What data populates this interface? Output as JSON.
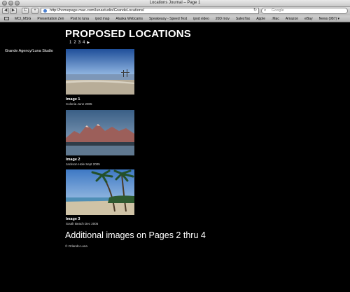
{
  "browser": {
    "window_title": "Locations Journal – Page 1",
    "back_label": "◀",
    "forward_label": "▶",
    "reload_label": "C",
    "add_label": "+",
    "url": "http://homepage.mac.com/lunastudio/GrandeLocations/",
    "search_placeholder": "Google",
    "bookmarks": [
      "MCI_MSG",
      "Presentation Zen",
      "Post to luna",
      "ipod map",
      "Alaska Webcams",
      "Speakeasy - Speed Test",
      "ipod video",
      "20D mov",
      "SalesTax",
      "Apple",
      ".Mac",
      "Amazon",
      "eBay",
      "News (987) ▾"
    ]
  },
  "page": {
    "title": "PROPOSED LOCATIONS",
    "pager": [
      "1",
      "2",
      "3",
      "4"
    ],
    "pager_next": "▶",
    "sidebar_link": "Grande Agency/Luna Studio",
    "images": [
      {
        "title": "Image 1",
        "subtitle": "Colonia June 2005"
      },
      {
        "title": "Image 2",
        "subtitle": "Jackson Hole Sept 2005"
      },
      {
        "title": "Image 3",
        "subtitle": "South Beach Dec 2005"
      }
    ],
    "more_text": "Additional images on Pages 2 thru 4",
    "copyright": "© Orlando Luna"
  }
}
